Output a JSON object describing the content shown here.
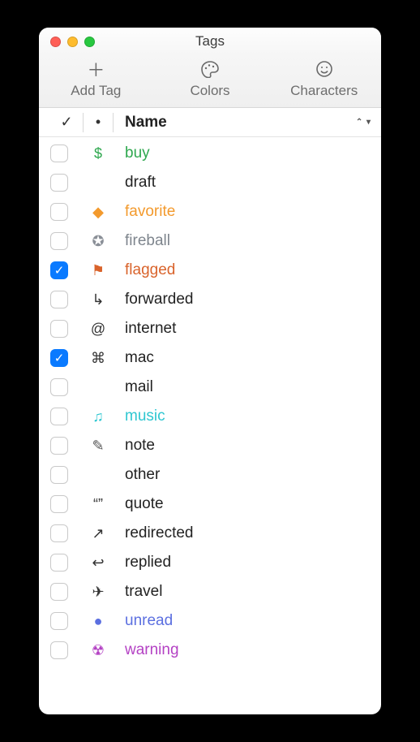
{
  "window": {
    "title": "Tags"
  },
  "toolbar": {
    "add_tag": "Add Tag",
    "colors": "Colors",
    "characters": "Characters"
  },
  "columns": {
    "check_glyph": "✓",
    "icon_glyph": "•",
    "name": "Name"
  },
  "rows": [
    {
      "checked": false,
      "icon": "$",
      "icon_color": "#2fa84f",
      "icon_name": "dollar-icon",
      "name": "buy",
      "name_color": "#2fa84f"
    },
    {
      "checked": false,
      "icon": "",
      "icon_color": "#444",
      "icon_name": "blank-icon",
      "name": "draft",
      "name_color": "#222"
    },
    {
      "checked": false,
      "icon": "◆",
      "icon_color": "#f39a2d",
      "icon_name": "diamond-icon",
      "name": "favorite",
      "name_color": "#f39a2d"
    },
    {
      "checked": false,
      "icon": "✪",
      "icon_color": "#8a8f97",
      "icon_name": "star-circle-icon",
      "name": "fireball",
      "name_color": "#7e858d"
    },
    {
      "checked": true,
      "icon": "⚑",
      "icon_color": "#d9632b",
      "icon_name": "flag-icon",
      "name": "flagged",
      "name_color": "#d9632b"
    },
    {
      "checked": false,
      "icon": "↳",
      "icon_color": "#333",
      "icon_name": "forward-arrow-icon",
      "name": "forwarded",
      "name_color": "#222"
    },
    {
      "checked": false,
      "icon": "@",
      "icon_color": "#333",
      "icon_name": "at-icon",
      "name": "internet",
      "name_color": "#222"
    },
    {
      "checked": true,
      "icon": "⌘",
      "icon_color": "#333",
      "icon_name": "command-icon",
      "name": "mac",
      "name_color": "#222"
    },
    {
      "checked": false,
      "icon": "",
      "icon_color": "#444",
      "icon_name": "blank-icon",
      "name": "mail",
      "name_color": "#222"
    },
    {
      "checked": false,
      "icon": "♫",
      "icon_color": "#2fc7d1",
      "icon_name": "music-note-icon",
      "name": "music",
      "name_color": "#2fc7d1"
    },
    {
      "checked": false,
      "icon": "✎",
      "icon_color": "#555",
      "icon_name": "pencil-icon",
      "name": "note",
      "name_color": "#222"
    },
    {
      "checked": false,
      "icon": "",
      "icon_color": "#444",
      "icon_name": "blank-icon",
      "name": "other",
      "name_color": "#222"
    },
    {
      "checked": false,
      "icon": "“”",
      "icon_color": "#333",
      "icon_name": "quote-icon",
      "name": "quote",
      "name_color": "#222"
    },
    {
      "checked": false,
      "icon": "↗",
      "icon_color": "#333",
      "icon_name": "redirect-arrow-icon",
      "name": "redirected",
      "name_color": "#222"
    },
    {
      "checked": false,
      "icon": "↩",
      "icon_color": "#333",
      "icon_name": "reply-arrow-icon",
      "name": "replied",
      "name_color": "#222"
    },
    {
      "checked": false,
      "icon": "✈",
      "icon_color": "#333",
      "icon_name": "airplane-icon",
      "name": "travel",
      "name_color": "#222"
    },
    {
      "checked": false,
      "icon": "●",
      "icon_color": "#5b6fe0",
      "icon_name": "dot-icon",
      "name": "unread",
      "name_color": "#5b6fe0"
    },
    {
      "checked": false,
      "icon": "☢",
      "icon_color": "#b442c4",
      "icon_name": "radiation-icon",
      "name": "warning",
      "name_color": "#b442c4"
    }
  ]
}
